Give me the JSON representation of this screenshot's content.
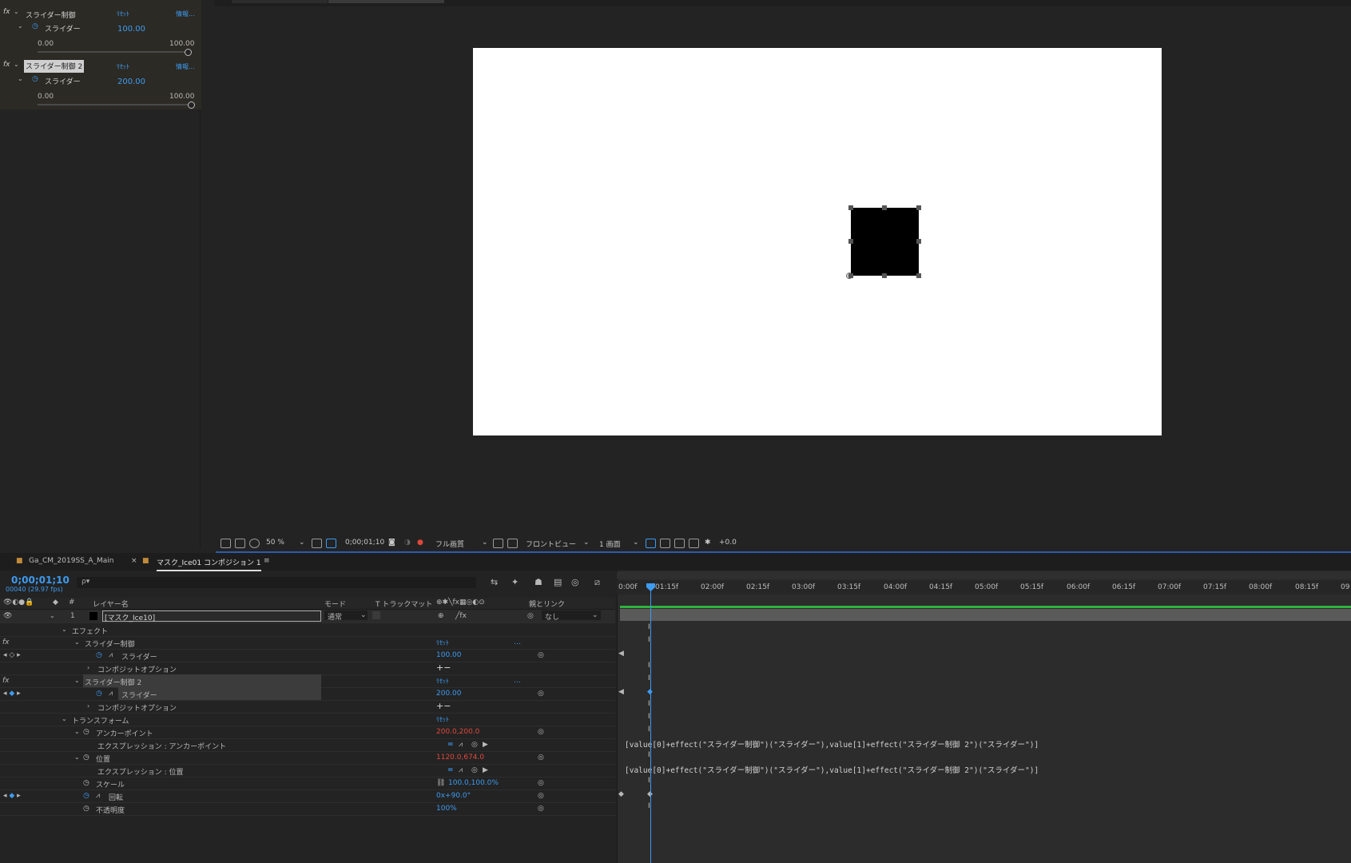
{
  "effect_controls": {
    "effects": [
      {
        "fx": "fx",
        "name": "スライダー制御",
        "reset": "ﾘｾｯﾄ",
        "info": "情報...",
        "param": "スライダー",
        "value": "100.00",
        "min": "0.00",
        "max": "100.00"
      },
      {
        "fx": "fx",
        "name": "スライダー制御 2",
        "reset": "ﾘｾｯﾄ",
        "info": "情報...",
        "param": "スライダー",
        "value": "200.00",
        "min": "0.00",
        "max": "100.00"
      }
    ]
  },
  "viewer": {
    "tabs": [
      "Ga_CM_2019SS_A_Main",
      "マスク_Ice01 コンポジション 1"
    ],
    "zoom": "50 %",
    "timecode": "0;00;01;10",
    "resolution": "フル画質",
    "view": "フロントビュー",
    "layout": "1 画面",
    "exposure": "+0.0"
  },
  "timeline": {
    "tabs": [
      "Ga_CM_2019SS_A_Main",
      "マスク_Ice01 コンポジション 1"
    ],
    "timecode": "0;00;01;10",
    "fps": "00040 (29.97 fps)",
    "search_placeholder": "ρ▾",
    "columns": {
      "layer_name": "レイヤー名",
      "mode": "モード",
      "trkmat": "T トラックマット",
      "parent": "親とリンク"
    },
    "layer": {
      "num": "1",
      "name": "[マスク_Ice10]",
      "mode": "通常",
      "parent": "なし"
    },
    "rows": {
      "effects": "エフェクト",
      "slider1": "スライダー制御",
      "slider1_reset": "ﾘｾｯﾄ",
      "slider1_param": "スライダー",
      "slider1_value": "100.00",
      "composite1": "コンポジットオプション",
      "composite1_value": "+−",
      "slider2": "スライダー制御 2",
      "slider2_reset": "ﾘｾｯﾄ",
      "slider2_param": "スライダー",
      "slider2_value": "200.00",
      "composite2": "コンポジットオプション",
      "composite2_value": "+−",
      "transform": "トランスフォーム",
      "transform_reset": "ﾘｾｯﾄ",
      "anchor": "アンカーポイント",
      "anchor_value": "200.0,200.0",
      "anchor_expr": "エクスプレッション : アンカーポイント",
      "position": "位置",
      "position_value": "1120.0,674.0",
      "position_expr": "エクスプレッション : 位置",
      "scale": "スケール",
      "scale_value": "100.0,100.0%",
      "rotation": "回転",
      "rotation_value": "0x+90.0°",
      "opacity": "不透明度",
      "opacity_value": "100%"
    },
    "ruler": [
      "0:00f",
      "01:15f",
      "02:00f",
      "02:15f",
      "03:00f",
      "03:15f",
      "04:00f",
      "04:15f",
      "05:00f",
      "05:15f",
      "06:00f",
      "06:15f",
      "07:00f",
      "07:15f",
      "08:00f",
      "08:15f",
      "09"
    ],
    "expressions": {
      "anchor": "[value[0]+effect(\"スライダー制御\")(\"スライダー\"),value[1]+effect(\"スライダー制御 2\")(\"スライダー\")]",
      "position": "[value[0]+effect(\"スライダー制御\")(\"スライダー\"),value[1]+effect(\"スライダー制御 2\")(\"スライダー\")]"
    }
  }
}
